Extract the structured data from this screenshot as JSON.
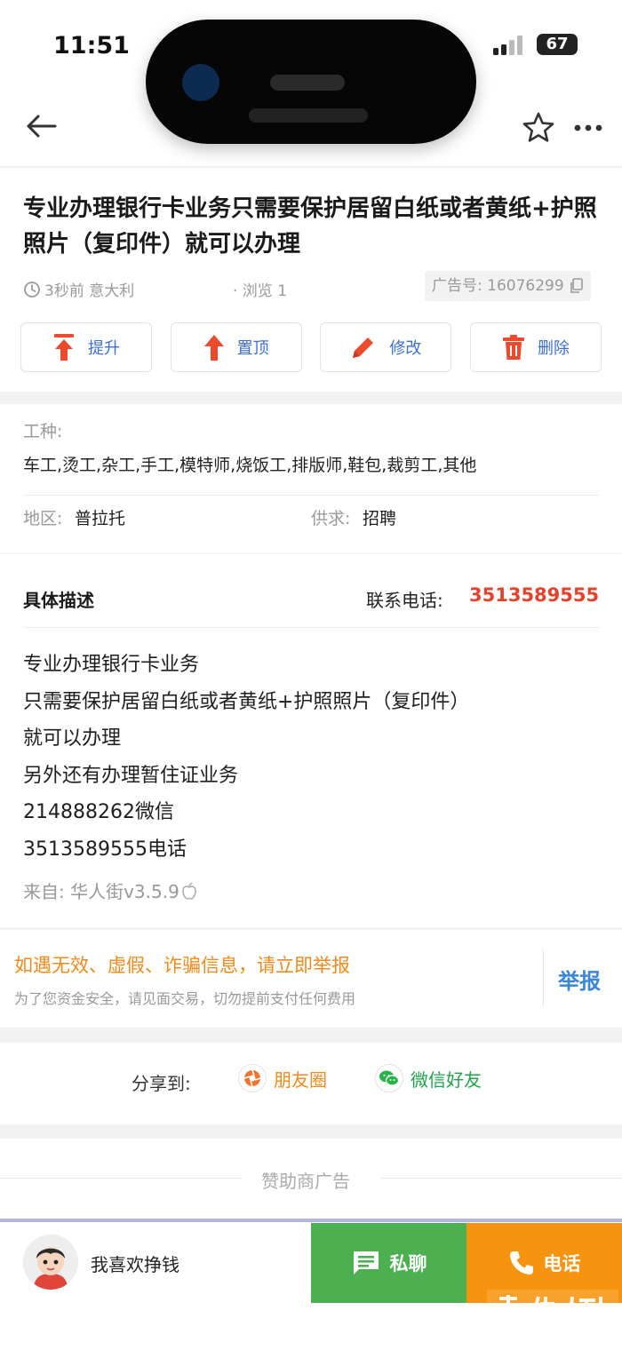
{
  "status_bar": {
    "time": "11:51",
    "battery": "67"
  },
  "post": {
    "title": "专业办理银行卡业务只需要保护居留白纸或者黄纸+护照照片（复印件）就可以办理",
    "time_location": "3秒前 意大利",
    "views": "· 浏览 1",
    "ad_number": "广告号: 16076299"
  },
  "actions": [
    {
      "label": "提升",
      "icon": "arrow-up-bar-icon"
    },
    {
      "label": "置顶",
      "icon": "arrow-up-icon"
    },
    {
      "label": "修改",
      "icon": "pencil-icon"
    },
    {
      "label": "删除",
      "icon": "trash-icon"
    }
  ],
  "info": {
    "job_type_label": "工种:",
    "job_type_value": "车工,烫工,杂工,手工,模特师,烧饭工,排版师,鞋包,裁剪工,其他",
    "region_label": "地区:",
    "region_value": "普拉托",
    "supply_label": "供求:",
    "supply_value": "招聘"
  },
  "description": {
    "heading": "具体描述",
    "phone_label": "联系电话:",
    "phone_value": "3513589555",
    "lines": [
      "专业办理银行卡业务",
      "只需要保护居留白纸或者黄纸+护照照片（复印件）",
      "就可以办理",
      "另外还有办理暂住证业务",
      "214888262微信",
      "3513589555电话"
    ],
    "from": "来自: 华人街v3.5.9"
  },
  "report": {
    "warning": "如遇无效、虚假、诈骗信息，请立即举报",
    "tip": "为了您资金安全，请见面交易，切勿提前支付任何费用",
    "button": "举报"
  },
  "share": {
    "label": "分享到:",
    "moments": "朋友圈",
    "friends": "微信好友"
  },
  "sponsor": {
    "label": "赞助商广告"
  },
  "bottom": {
    "nickname": "我喜欢挣钱",
    "chat": "私聊",
    "call": "电话"
  },
  "colors": {
    "accent_blue": "#3a6fd8",
    "phone_red": "#e5412d",
    "warn_orange": "#f08a1c",
    "chat_green": "#4caf50",
    "call_orange": "#f7940f"
  }
}
